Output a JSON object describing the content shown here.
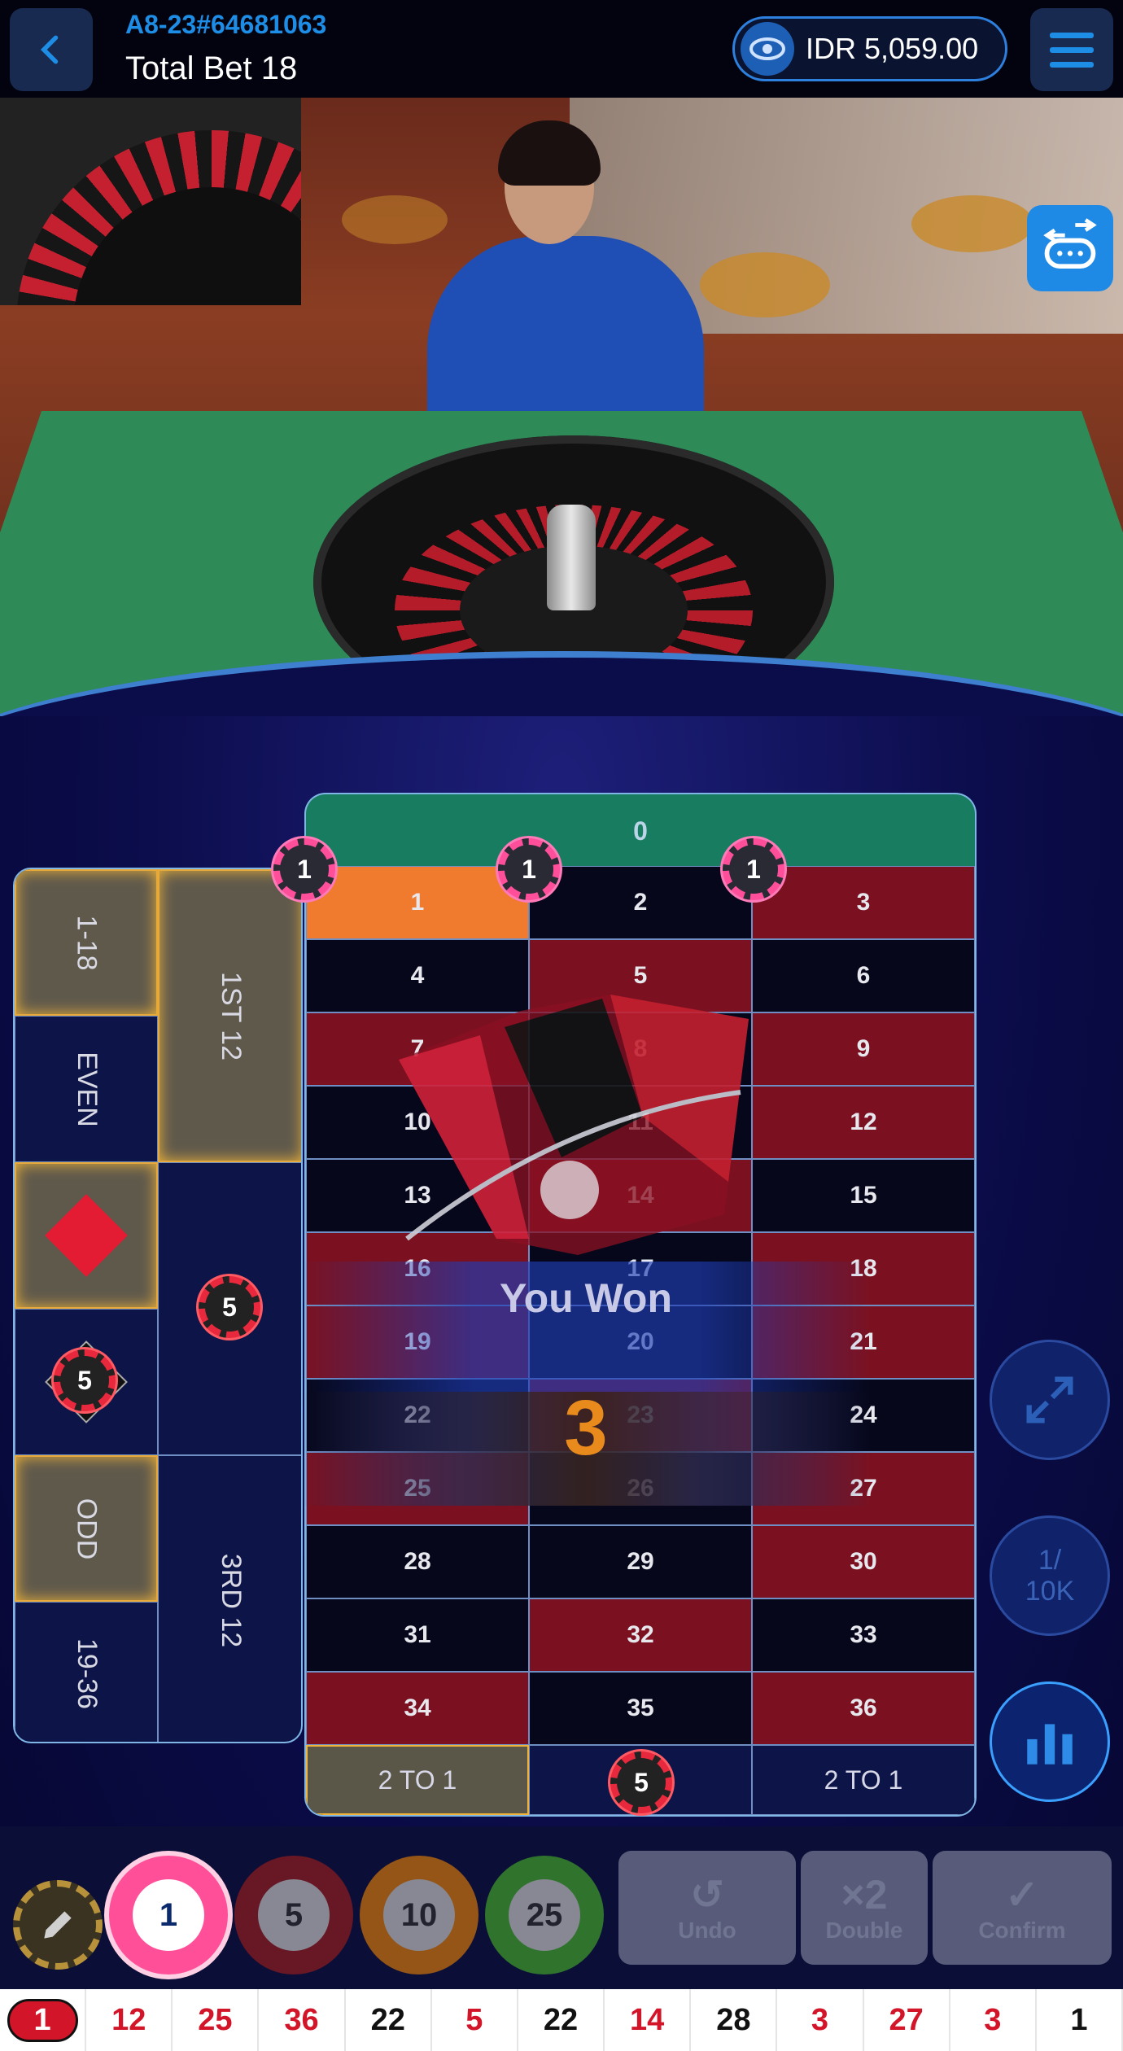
{
  "header": {
    "table_id": "A8-23#64681063",
    "total_bet": "Total Bet 18",
    "balance": "IDR 5,059.00"
  },
  "board": {
    "zero": "0",
    "rows": [
      [
        "1",
        "2",
        "3"
      ],
      [
        "4",
        "5",
        "6"
      ],
      [
        "7",
        "8",
        "9"
      ],
      [
        "10",
        "11",
        "12"
      ],
      [
        "13",
        "14",
        "15"
      ],
      [
        "16",
        "17",
        "18"
      ],
      [
        "19",
        "20",
        "21"
      ],
      [
        "22",
        "23",
        "24"
      ],
      [
        "25",
        "26",
        "27"
      ],
      [
        "28",
        "29",
        "30"
      ],
      [
        "31",
        "32",
        "33"
      ],
      [
        "34",
        "35",
        "36"
      ]
    ],
    "row_colors": [
      [
        "hi",
        "black",
        "red"
      ],
      [
        "black",
        "red",
        "black"
      ],
      [
        "red",
        "black",
        "red"
      ],
      [
        "black",
        "black",
        "red"
      ],
      [
        "black",
        "red",
        "black"
      ],
      [
        "red",
        "black",
        "red"
      ],
      [
        "red",
        "black",
        "red"
      ],
      [
        "black",
        "red",
        "black"
      ],
      [
        "red",
        "black",
        "red"
      ],
      [
        "black",
        "black",
        "red"
      ],
      [
        "black",
        "red",
        "black"
      ],
      [
        "red",
        "black",
        "red"
      ]
    ],
    "columns": [
      "2 TO 1",
      "",
      "2 TO 1"
    ],
    "outside": {
      "low": "1-18",
      "even": "EVEN",
      "odd": "ODD",
      "high": "19-36",
      "first12": "1ST 12",
      "third12": "3RD 12"
    },
    "chips_on_board": [
      "1",
      "1",
      "1",
      "5",
      "5",
      "5"
    ]
  },
  "result": {
    "title": "You Won",
    "number": "3"
  },
  "side_buttons": {
    "limit": "1/\n10K"
  },
  "tray": {
    "chips": [
      "1",
      "5",
      "10",
      "25"
    ],
    "undo": "Undo",
    "double": "Double",
    "double_icon": "×2",
    "confirm": "Confirm"
  },
  "history": [
    {
      "v": "1",
      "c": "r"
    },
    {
      "v": "12",
      "c": "r"
    },
    {
      "v": "25",
      "c": "r"
    },
    {
      "v": "36",
      "c": "r"
    },
    {
      "v": "22",
      "c": "b"
    },
    {
      "v": "5",
      "c": "r"
    },
    {
      "v": "22",
      "c": "b"
    },
    {
      "v": "14",
      "c": "r"
    },
    {
      "v": "28",
      "c": "b"
    },
    {
      "v": "3",
      "c": "r"
    },
    {
      "v": "27",
      "c": "r"
    },
    {
      "v": "3",
      "c": "r"
    },
    {
      "v": "1",
      "c": "b"
    }
  ],
  "colors": {
    "accent": "#1d8de6",
    "red": "#7b1120",
    "green": "#187d60",
    "gold": "#f0b43a"
  },
  "icons": [
    "back-arrow-icon",
    "eye-icon",
    "hamburger-menu-icon",
    "switch-view-icon",
    "fullscreen-icon",
    "stats-icon",
    "pencil-icon",
    "undo-icon",
    "confirm-check-icon"
  ]
}
